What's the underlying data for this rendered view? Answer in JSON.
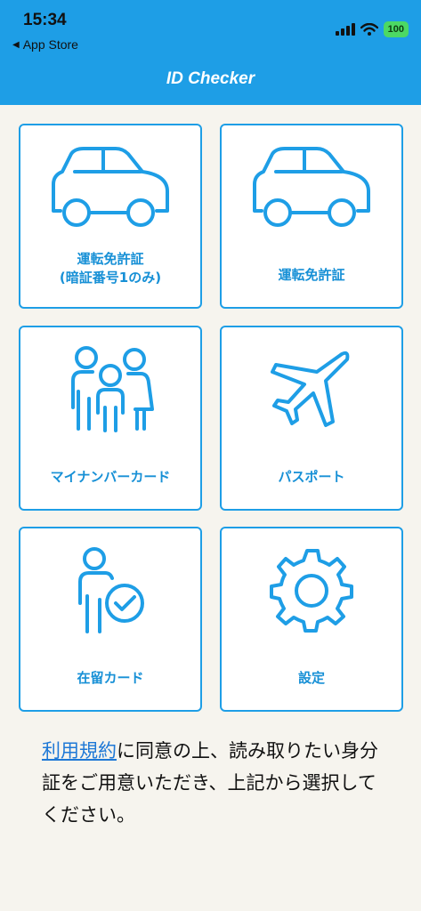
{
  "status_bar": {
    "time": "15:34",
    "back_label": "App Store",
    "battery": "100"
  },
  "header": {
    "title": "ID Checker"
  },
  "tiles": [
    {
      "label_line1": "運転免許証",
      "label_line2": "(暗証番号1のみ)",
      "icon": "car-icon"
    },
    {
      "label_line1": "運転免許証",
      "icon": "car-icon"
    },
    {
      "label_line1": "マイナンバーカード",
      "icon": "family-icon"
    },
    {
      "label_line1": "パスポート",
      "icon": "airplane-icon"
    },
    {
      "label_line1": "在留カード",
      "icon": "person-check-icon"
    },
    {
      "label_line1": "設定",
      "icon": "gear-icon"
    }
  ],
  "notice": {
    "terms_link": "利用規約",
    "text_part1": "に同意の上、読み取りたい身分証をご用意いただき、上記から選択してください。"
  },
  "colors": {
    "accent": "#1e9ee6",
    "background": "#f6f4ee",
    "label": "#1790d6"
  }
}
